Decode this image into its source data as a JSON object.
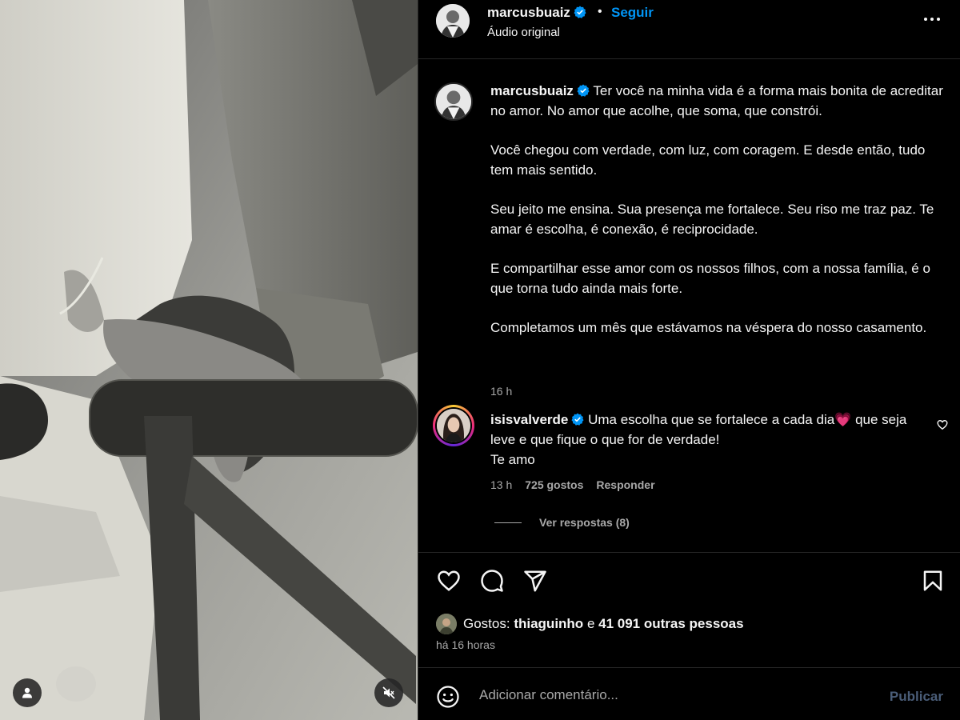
{
  "post": {
    "author": "marcusbuaiz",
    "follow_label": "Seguir",
    "separator": "•",
    "audio_label": "Áudio original",
    "more_icon": "more-horizontal-icon"
  },
  "caption": {
    "username": "marcusbuaiz",
    "paragraphs": [
      "Ter você na minha vida é a forma mais bonita de acreditar no amor. No amor que acolhe, que soma, que constrói.",
      "Você chegou com verdade, com luz, com coragem. E desde então, tudo tem mais sentido.",
      "Seu jeito me ensina. Sua presença me fortalece. Seu riso me traz paz. Te amar é escolha, é conexão, é reciprocidade.",
      "E compartilhar esse amor com os nossos filhos, com a nossa família, é o que torna tudo ainda mais forte.",
      "Completamos um mês que estávamos na véspera do nosso casamento."
    ],
    "time": "16 h"
  },
  "comment": {
    "username": "isisvalverde",
    "text_part1": "Uma escolha que se fortalece a cada dia",
    "emoji": "💗",
    "text_part2": " que seja leve e que fique o que for de verdade!",
    "text_line3": "Te amo",
    "time": "13 h",
    "likes": "725 gostos",
    "reply_label": "Responder",
    "view_replies": "Ver respostas (8)"
  },
  "actions": {
    "likes_prefix": "Gostos:",
    "liked_by": "thiaguinho",
    "conjunction": "e",
    "others": "41 091 outras pessoas",
    "date": "há 16 horas"
  },
  "composer": {
    "placeholder": "Adicionar comentário...",
    "publish_label": "Publicar"
  },
  "colors": {
    "background": "#000000",
    "link_blue": "#0095f6",
    "muted_text": "#a8a8a8",
    "divider": "#262626",
    "publish_disabled": "#4a5d78",
    "verified_badge": "#0095f6"
  }
}
